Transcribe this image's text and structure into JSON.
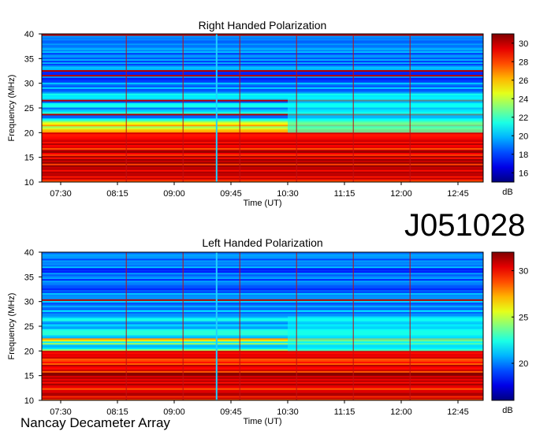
{
  "observation_id": "J051028",
  "instrument": "Nancay Decameter Array",
  "colors": {
    "axis": "#000000",
    "hot": "#b40000",
    "background": "#1030c0"
  },
  "chart_data": [
    {
      "type": "heatmap",
      "title": "Right Handed Polarization",
      "xlabel": "Time (UT)",
      "ylabel": "Frequency (MHz)",
      "x_ticks": [
        "07:30",
        "08:15",
        "09:00",
        "09:45",
        "10:30",
        "11:15",
        "12:00",
        "12:45"
      ],
      "y_ticks": [
        10,
        15,
        20,
        25,
        30,
        35,
        40
      ],
      "ylim": [
        10,
        40
      ],
      "colorbar": {
        "label": "dB",
        "ticks": [
          16,
          18,
          20,
          22,
          24,
          26,
          28,
          30
        ],
        "range": [
          15,
          31
        ]
      },
      "colormap": "jet"
    },
    {
      "type": "heatmap",
      "title": "Left Handed Polarization",
      "xlabel": "Time (UT)",
      "ylabel": "Frequency (MHz)",
      "x_ticks": [
        "07:30",
        "08:15",
        "09:00",
        "09:45",
        "10:30",
        "11:15",
        "12:00",
        "12:45"
      ],
      "y_ticks": [
        10,
        15,
        20,
        25,
        30,
        35,
        40
      ],
      "ylim": [
        10,
        40
      ],
      "colorbar": {
        "label": "dB",
        "ticks": [
          20,
          25,
          30
        ],
        "range": [
          16,
          32
        ]
      },
      "colormap": "jet"
    }
  ]
}
